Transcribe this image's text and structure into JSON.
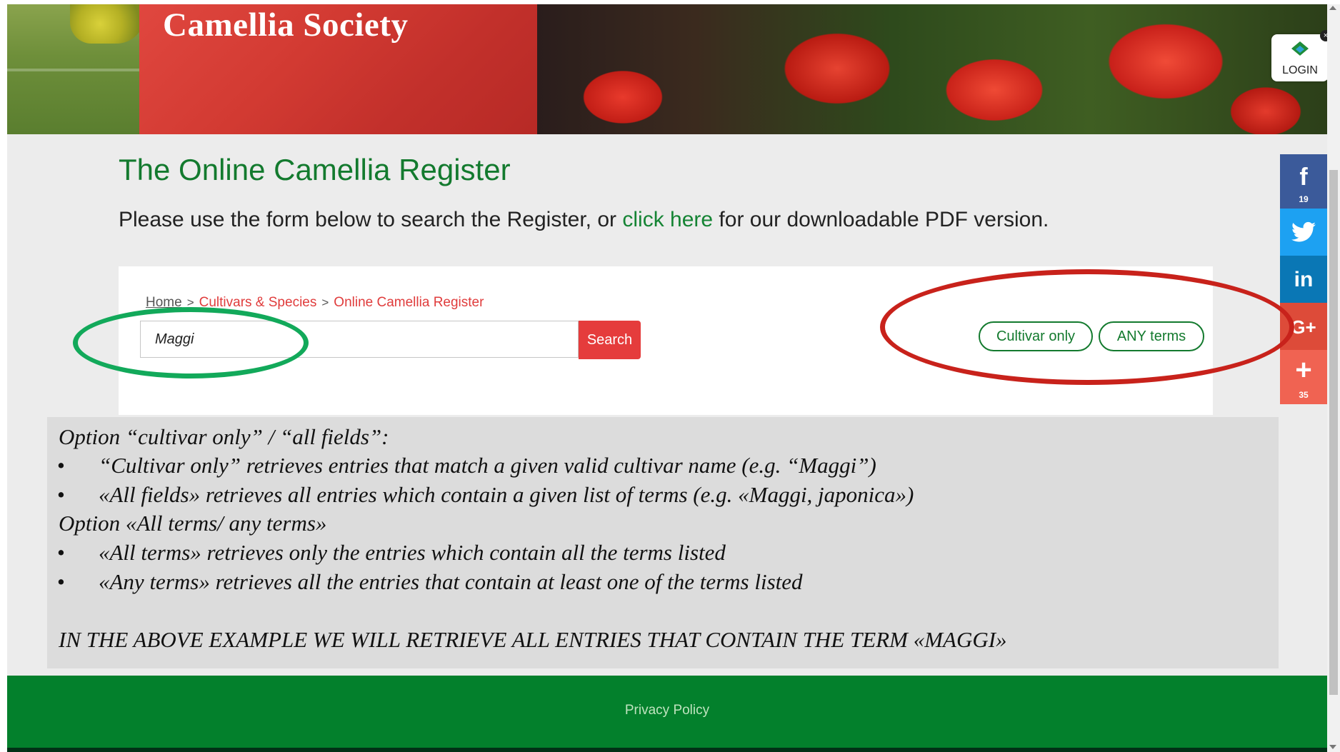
{
  "banner": {
    "title": "Camellia Society",
    "login_label": "LOGIN",
    "close_glyph": "×"
  },
  "headline": "The Online Camellia Register",
  "intro": {
    "before": "Please use the form below to search the Register, or ",
    "link": "click here",
    "after": " for our downloadable PDF version."
  },
  "breadcrumb": {
    "home": "Home",
    "separator": ">",
    "cultivars": "Cultivars & Species",
    "current": "Online Camellia Register"
  },
  "search": {
    "value": "Maggi",
    "button": "Search"
  },
  "options": {
    "cultivar_only": "Cultivar only",
    "any_terms": "ANY terms"
  },
  "social": {
    "facebook_count": "19",
    "more_count": "35",
    "icons": [
      "facebook-icon",
      "twitter-icon",
      "linkedin-icon",
      "google-plus-icon",
      "plus-icon"
    ],
    "colors": {
      "facebook": "#3b5a9a",
      "twitter": "#1da1f2",
      "linkedin": "#0a77b5",
      "google_plus": "#dd4b39",
      "more": "#f06352"
    }
  },
  "notes": {
    "heading1": "Option “cultivar  only” / “all fields”:",
    "bullet1": "“Cultivar only” retrieves entries that match a given valid  cultivar name (e.g. “Maggi”)",
    "bullet2": "«All fields» retrieves all entries which contain a given list of terms (e.g. «Maggi, japonica»)",
    "heading2": "Option «All terms/ any terms»",
    "bullet3": "«All  terms» retrieves only the entries which contain all the terms listed",
    "bullet4": "«Any terms» retrieves all the entries that contain at least one of the terms listed",
    "conclusion": "IN THE ABOVE EXAMPLE WE WILL RETRIEVE ALL ENTRIES THAT CONTAIN THE TERM «MAGGI»",
    "bullet_glyph": "•"
  },
  "footer": {
    "privacy": "Privacy Policy"
  },
  "colors": {
    "brand_green": "#137a2e",
    "accent_red": "#e53c3c",
    "footer_green": "#03802c",
    "annotation_green": "#12a95a",
    "annotation_red": "#c8221b"
  }
}
